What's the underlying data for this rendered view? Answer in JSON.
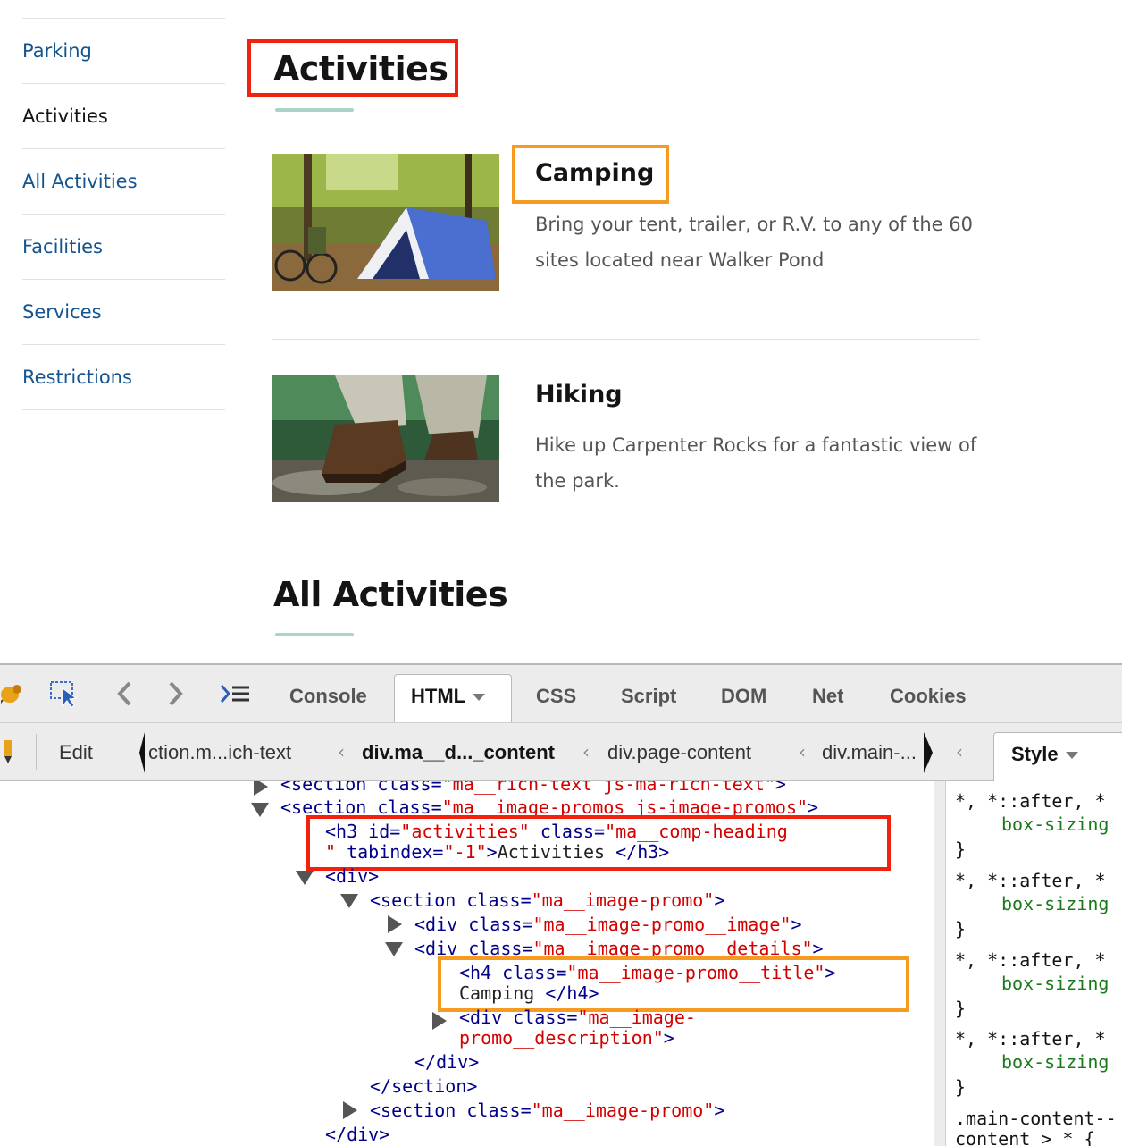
{
  "sidebar": {
    "items": [
      {
        "label": "Parking"
      },
      {
        "label": "Activities"
      },
      {
        "label": "All Activities"
      },
      {
        "label": "Facilities"
      },
      {
        "label": "Services"
      },
      {
        "label": "Restrictions"
      }
    ]
  },
  "main": {
    "heading": "Activities",
    "promos": [
      {
        "title": "Camping",
        "description": "Bring your tent, trailer, or R.V. to any of the 60 sites located near Walker Pond"
      },
      {
        "title": "Hiking",
        "description": "Hike up Carpenter Rocks for a fantastic view of the park."
      }
    ],
    "heading2": "All Activities"
  },
  "devtools": {
    "tabs": [
      "Console",
      "HTML",
      "CSS",
      "Script",
      "DOM",
      "Net",
      "Cookies"
    ],
    "edit_label": "Edit",
    "breadcrumbs": [
      "ction.m...ich-text",
      "div.ma__d..._content",
      "div.page-content",
      "div.main-..."
    ],
    "side_tab": "Style",
    "html_lines": {
      "l0_tag": "<section",
      "l0_attr": " class=",
      "l0_val": "\"ma__rich-text js-ma-rich-text\"",
      "l0_end": ">",
      "l1_tag": "<section",
      "l1_attr": " class=",
      "l1_val": "\"ma__image-promos js-image-promos\"",
      "l1_end": ">",
      "l2_tag": "<h3",
      "l2_attr1": " id=",
      "l2_val1": "\"activities\"",
      "l2_attr2": " class=",
      "l2_val2": "\"ma__comp-heading",
      "l3_val": "\"",
      "l3_attr": " tabindex=",
      "l3_val2": "\"-1\"",
      "l3_gt": ">",
      "l3_text": "Activities ",
      "l3_close": "</h3>",
      "l4": "<div>",
      "l5_tag": "<section",
      "l5_attr": " class=",
      "l5_val": "\"ma__image-promo\"",
      "l5_end": ">",
      "l6_tag": "<div",
      "l6_attr": " class=",
      "l6_val": "\"ma__image-promo__image\"",
      "l6_end": ">",
      "l7_tag": "<div",
      "l7_attr": " class=",
      "l7_val": "\"ma__image-promo__details\"",
      "l7_end": ">",
      "l8_tag": "<h4",
      "l8_attr": " class=",
      "l8_val": "\"ma__image-promo__title\"",
      "l8_end": ">",
      "l9_text": "Camping ",
      "l9_close": "</h4>",
      "l10_tag": "<div",
      "l10_attr": " class=",
      "l10_val": "\"ma__image-",
      "l11_val": "promo__description\"",
      "l11_end": ">",
      "l12": "</div>",
      "l13": "</section>",
      "l14_tag": "<section",
      "l14_attr": " class=",
      "l14_val": "\"ma__image-promo\"",
      "l14_end": ">",
      "l15": "</div>"
    },
    "style_rules": {
      "r1_sel": "*, *::after, *",
      "r1_prop": "box-sizing",
      "close": "}",
      "last_sel": ".main-content--",
      "last_sel2": "content > * {"
    }
  },
  "colors": {
    "link": "#14558f",
    "annotation_red": "#f2200d",
    "annotation_orange": "#f79a22",
    "heading_underline": "#a8d4c9"
  }
}
